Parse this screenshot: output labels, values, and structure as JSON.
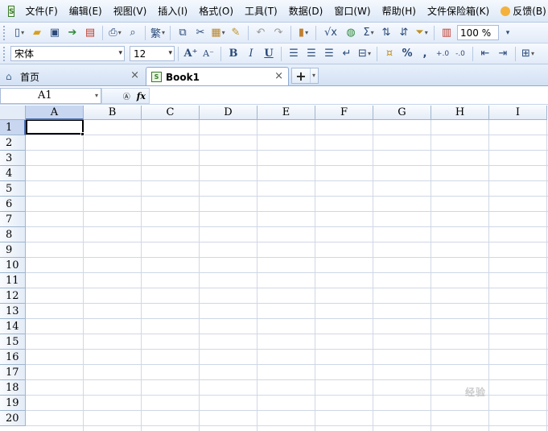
{
  "menu": {
    "items": [
      "文件(F)",
      "编辑(E)",
      "视图(V)",
      "插入(I)",
      "格式(O)",
      "工具(T)",
      "数据(D)",
      "窗口(W)",
      "帮助(H)",
      "文件保险箱(K)"
    ],
    "feedback": "反馈(B)"
  },
  "toolbar": {
    "traditional_char": "繁",
    "sum_symbol": "Σ",
    "zoom": "100 %",
    "font_name": "宋体",
    "font_size": "12",
    "bold": "B",
    "italic": "I",
    "underline": "U",
    "percent": "%"
  },
  "tabs": {
    "home": "首页",
    "book": "Book1"
  },
  "formula_bar": {
    "name_box": "A1",
    "fx": "fx",
    "value": ""
  },
  "sheet": {
    "columns": [
      "A",
      "B",
      "C",
      "D",
      "E",
      "F",
      "G",
      "H",
      "I"
    ],
    "rows": [
      "1",
      "2",
      "3",
      "4",
      "5",
      "6",
      "7",
      "8",
      "9",
      "10",
      "11",
      "12",
      "13",
      "14",
      "15",
      "16",
      "17",
      "18",
      "19",
      "20"
    ],
    "active_cell": "A1"
  },
  "colors": {
    "header_bg": "#e4ecf7",
    "selected_header": "#c8d6f0",
    "grid_line": "#d0d7e5"
  }
}
